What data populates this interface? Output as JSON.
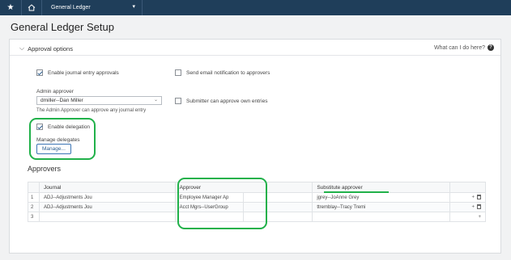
{
  "topbar": {
    "star_icon": "star-icon",
    "home_icon": "home-icon",
    "module_label": "General Ledger"
  },
  "page_title": "General Ledger Setup",
  "section": {
    "title": "Approval options",
    "help_label": "What can I do here?"
  },
  "options": {
    "enable_journal_entry": "Enable journal entry approvals",
    "send_email": "Send email notification to approvers",
    "admin_approver_label": "Admin approver",
    "admin_approver_value": "dmiller--Dan Miller",
    "admin_help": "The Admin Approver can approve any journal entry",
    "submitter_can_approve": "Submitter can approve own entries",
    "enable_delegation": "Enable delegation",
    "manage_delegates_label": "Manage delegates",
    "manage_button": "Manage..."
  },
  "approvers": {
    "title": "Approvers",
    "columns": [
      "Journal",
      "Approver",
      "Substitute approver"
    ],
    "rows": [
      {
        "num": "1",
        "journal": "ADJ--Adjustments Jou",
        "approver": "Employee Manager Ap",
        "substitute": "jgrey--JoAnne Grey"
      },
      {
        "num": "2",
        "journal": "ADJ--Adjustments Jou",
        "approver": "Acct Mgrs--UserGroup",
        "substitute": "ttremblay--Tracy Tremi"
      },
      {
        "num": "3",
        "journal": "",
        "approver": "",
        "substitute": ""
      }
    ]
  },
  "colors": {
    "topbar": "#1f3e5a",
    "highlight": "#21b14a",
    "accent": "#2a5d8f"
  }
}
